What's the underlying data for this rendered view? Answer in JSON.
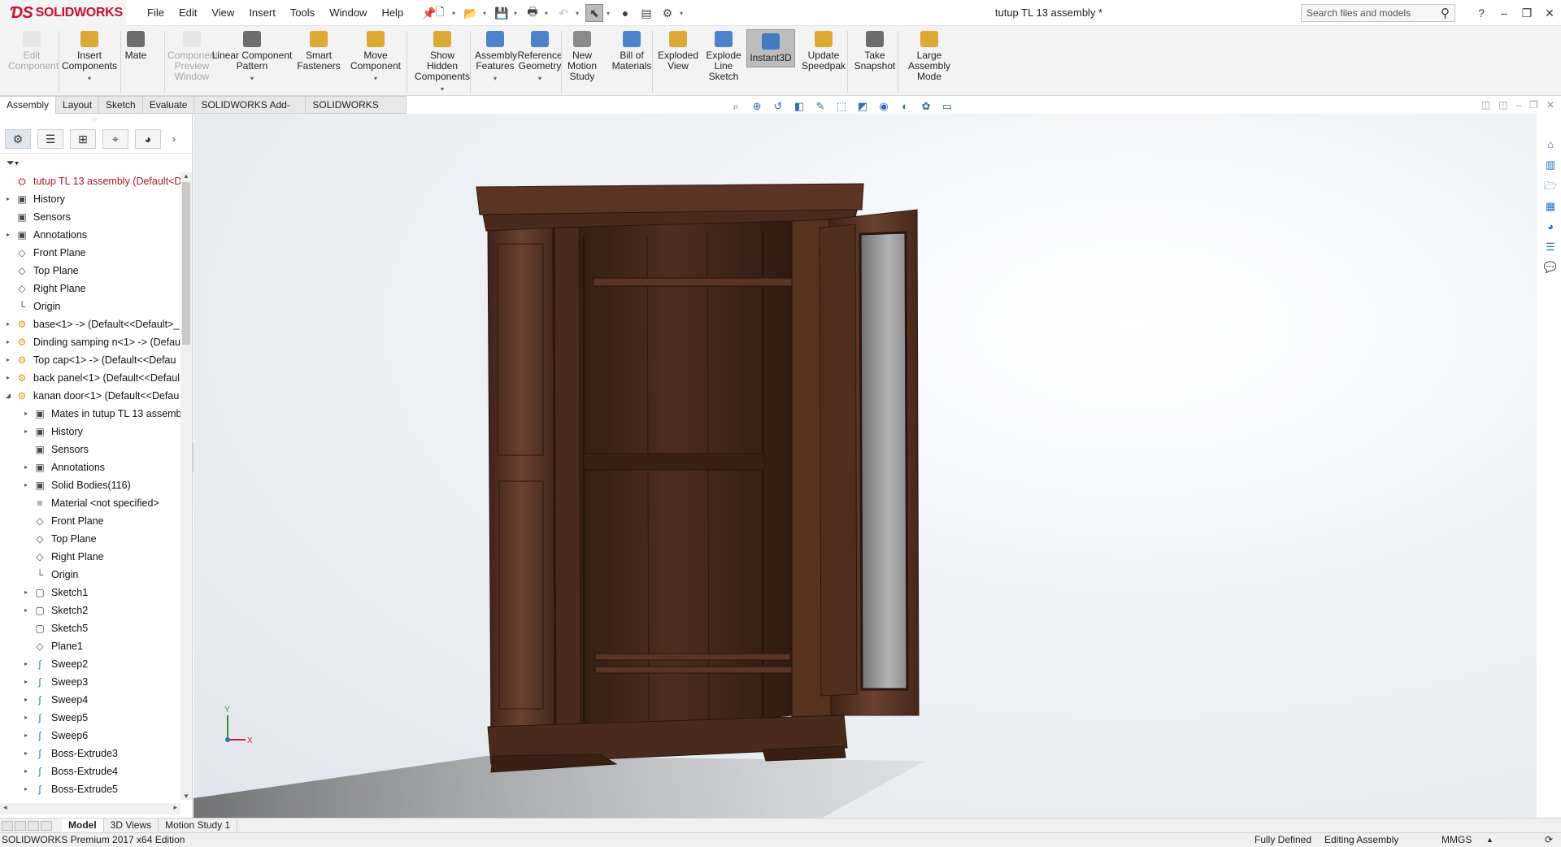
{
  "app": {
    "logo_text": "SOLIDWORKS",
    "document_title": "tutup TL 13 assembly *"
  },
  "menu": [
    "File",
    "Edit",
    "View",
    "Insert",
    "Tools",
    "Window",
    "Help"
  ],
  "search": {
    "placeholder": "Search files and models"
  },
  "ribbon": [
    {
      "label": "Edit\nComponent",
      "icon": "edit-component-icon",
      "disabled": true
    },
    {
      "label": "Insert\nComponents",
      "icon": "insert-components-icon"
    },
    {
      "label": "Mate",
      "icon": "mate-icon"
    },
    {
      "label": "Component\nPreview\nWindow",
      "icon": "preview-window-icon",
      "disabled": true
    },
    {
      "label": "Linear Component\nPattern",
      "icon": "linear-pattern-icon"
    },
    {
      "label": "Smart\nFasteners",
      "icon": "smart-fasteners-icon"
    },
    {
      "label": "Move\nComponent",
      "icon": "move-component-icon"
    },
    {
      "label": "Show\nHidden\nComponents",
      "icon": "show-hidden-icon"
    },
    {
      "label": "Assembly\nFeatures",
      "icon": "assembly-features-icon"
    },
    {
      "label": "Reference\nGeometry",
      "icon": "reference-geometry-icon"
    },
    {
      "label": "New\nMotion\nStudy",
      "icon": "motion-study-icon"
    },
    {
      "label": "Bill of\nMaterials",
      "icon": "bom-icon"
    },
    {
      "label": "Exploded\nView",
      "icon": "exploded-view-icon"
    },
    {
      "label": "Explode\nLine\nSketch",
      "icon": "explode-line-icon"
    },
    {
      "label": "Instant3D",
      "icon": "instant3d-icon",
      "active": true
    },
    {
      "label": "Update\nSpeedpak",
      "icon": "speedpak-icon"
    },
    {
      "label": "Take\nSnapshot",
      "icon": "snapshot-icon"
    },
    {
      "label": "Large\nAssembly\nMode",
      "icon": "large-assembly-icon"
    }
  ],
  "command_tabs": [
    "Assembly",
    "Layout",
    "Sketch",
    "Evaluate",
    "SOLIDWORKS Add-Ins",
    "SOLIDWORKS MBD"
  ],
  "tree": [
    {
      "label": "tutup TL 13 assembly  (Default<D",
      "type": "root"
    },
    {
      "label": "History",
      "type": "folder",
      "expand": true
    },
    {
      "label": "Sensors",
      "type": "folder"
    },
    {
      "label": "Annotations",
      "type": "folder",
      "expand": true
    },
    {
      "label": "Front Plane",
      "type": "plane"
    },
    {
      "label": "Top Plane",
      "type": "plane"
    },
    {
      "label": "Right Plane",
      "type": "plane"
    },
    {
      "label": "Origin",
      "type": "origin"
    },
    {
      "label": "base<1> -> (Default<<Default>_",
      "type": "comp",
      "expand": true
    },
    {
      "label": "Dinding samping n<1> -> (Defau",
      "type": "comp",
      "expand": true
    },
    {
      "label": "Top cap<1> -> (Default<<Defau",
      "type": "comp",
      "expand": true
    },
    {
      "label": "back panel<1> (Default<<Defaul",
      "type": "comp",
      "expand": true
    },
    {
      "label": "kanan door<1> (Default<<Defau",
      "type": "comp",
      "open": true
    },
    {
      "label": "Mates in tutup TL 13 assemb",
      "type": "folder",
      "indent": 1,
      "expand": true
    },
    {
      "label": "History",
      "type": "folder",
      "indent": 1,
      "expand": true
    },
    {
      "label": "Sensors",
      "type": "folder",
      "indent": 1
    },
    {
      "label": "Annotations",
      "type": "folder",
      "indent": 1,
      "expand": true
    },
    {
      "label": "Solid Bodies(116)",
      "type": "folder",
      "indent": 1,
      "expand": true
    },
    {
      "label": "Material <not specified>",
      "type": "material",
      "indent": 1
    },
    {
      "label": "Front Plane",
      "type": "plane",
      "indent": 1
    },
    {
      "label": "Top Plane",
      "type": "plane",
      "indent": 1
    },
    {
      "label": "Right Plane",
      "type": "plane",
      "indent": 1
    },
    {
      "label": "Origin",
      "type": "origin",
      "indent": 1
    },
    {
      "label": "Sketch1",
      "type": "sketch",
      "indent": 1,
      "expand": true
    },
    {
      "label": "Sketch2",
      "type": "sketch",
      "indent": 1,
      "expand": true
    },
    {
      "label": "Sketch5",
      "type": "sketch",
      "indent": 1
    },
    {
      "label": "Plane1",
      "type": "plane",
      "indent": 1
    },
    {
      "label": "Sweep2",
      "type": "feat",
      "indent": 1,
      "expand": true
    },
    {
      "label": "Sweep3",
      "type": "feat",
      "indent": 1,
      "expand": true
    },
    {
      "label": "Sweep4",
      "type": "feat",
      "indent": 1,
      "expand": true
    },
    {
      "label": "Sweep5",
      "type": "feat",
      "indent": 1,
      "expand": true
    },
    {
      "label": "Sweep6",
      "type": "feat",
      "indent": 1,
      "expand": true
    },
    {
      "label": "Boss-Extrude3",
      "type": "feat",
      "indent": 1,
      "expand": true
    },
    {
      "label": "Boss-Extrude4",
      "type": "feat",
      "indent": 1,
      "expand": true
    },
    {
      "label": "Boss-Extrude5",
      "type": "feat",
      "indent": 1,
      "expand": true
    }
  ],
  "bottom_tabs": [
    "Model",
    "3D Views",
    "Motion Study 1"
  ],
  "status": {
    "edition": "SOLIDWORKS Premium 2017 x64 Edition",
    "defined": "Fully Defined",
    "mode": "Editing Assembly",
    "units": "MMGS"
  },
  "triad": {
    "y_label": "Y",
    "x_label": "X"
  },
  "colors": {
    "brand": "#c8102e",
    "wood": "#5a3524",
    "accent": "#2f6fc2"
  }
}
